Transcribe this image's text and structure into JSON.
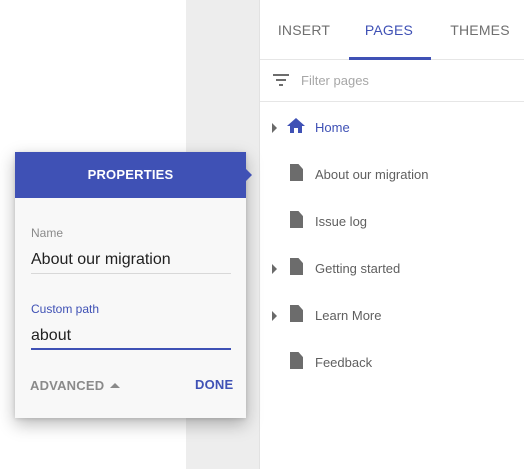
{
  "tabs": [
    {
      "label": "INSERT"
    },
    {
      "label": "PAGES"
    },
    {
      "label": "THEMES"
    }
  ],
  "filter": {
    "placeholder": "Filter pages",
    "icon": "filter-icon"
  },
  "pages": [
    {
      "label": "Home",
      "icon": "home-icon",
      "expandable": true,
      "active": true
    },
    {
      "label": "About our migration",
      "icon": "page-icon",
      "expandable": false
    },
    {
      "label": "Issue log",
      "icon": "page-icon",
      "expandable": false
    },
    {
      "label": "Getting started",
      "icon": "page-icon",
      "expandable": true
    },
    {
      "label": "Learn More",
      "icon": "page-icon",
      "expandable": true
    },
    {
      "label": "Feedback",
      "icon": "page-icon",
      "expandable": false
    }
  ],
  "properties": {
    "title": "PROPERTIES",
    "name_label": "Name",
    "name_value": "About our migration",
    "path_label": "Custom path",
    "path_value": "about",
    "advanced_label": "ADVANCED",
    "done_label": "DONE"
  },
  "colors": {
    "accent": "#3f51b5",
    "icon_gray": "#6c6c6c",
    "gutter": "#ededed"
  }
}
